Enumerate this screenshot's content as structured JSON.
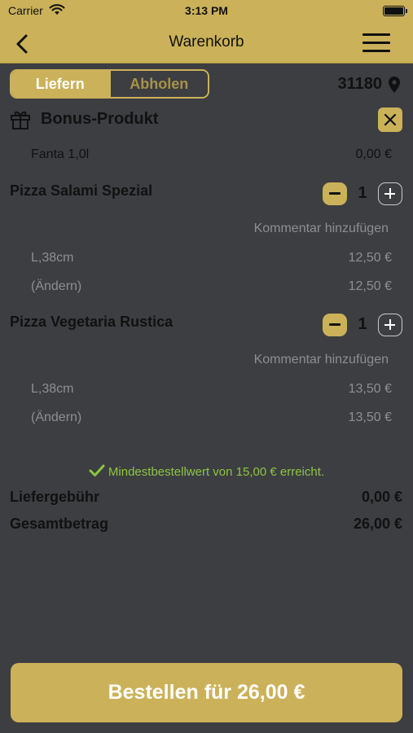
{
  "status_bar": {
    "carrier": "Carrier",
    "time": "3:13 PM"
  },
  "nav": {
    "title": "Warenkorb"
  },
  "delivery_toggle": {
    "options": [
      "Liefern",
      "Abholen"
    ],
    "selected": "Liefern"
  },
  "postal_code": "31180",
  "bonus": {
    "title": "Bonus-Produkt",
    "product": "Fanta 1,0l",
    "price": "0,00 €"
  },
  "items": [
    {
      "name": "Pizza Salami Spezial",
      "quantity": "1",
      "comment_label": "Kommentar hinzufügen",
      "size": "L,38cm",
      "size_price": "12,50 €",
      "edit_label": "(Ändern)",
      "edit_price": "12,50 €"
    },
    {
      "name": "Pizza Vegetaria Rustica",
      "quantity": "1",
      "comment_label": "Kommentar hinzufügen",
      "size": "L,38cm",
      "size_price": "13,50 €",
      "edit_label": "(Ändern)",
      "edit_price": "13,50 €"
    }
  ],
  "min_order_notice": "Mindestbestellwert von 15,00 € erreicht.",
  "summary": {
    "delivery_fee_label": "Liefergebühr",
    "delivery_fee": "0,00 €",
    "total_label": "Gesamtbetrag",
    "total": "26,00 €"
  },
  "order_button": "Bestellen für 26,00 €",
  "colors": {
    "accent": "#cbb159",
    "background": "#3d3e41",
    "success": "#8cc640",
    "muted_text": "#8d8e91"
  }
}
